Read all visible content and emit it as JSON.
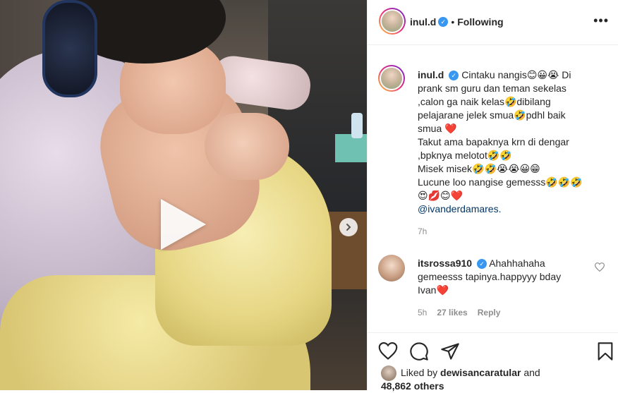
{
  "post": {
    "author": "inul.d",
    "follow_state": "Following",
    "more_label": "•••",
    "caption": {
      "username": "inul.d",
      "lines": [
        "Cintaku nangis😊😀😭 Di",
        "prank sm guru dan teman sekelas",
        ",calon ga naik kelas🤣dibilang",
        "pelajarane jelek smua🤣pdhl baik",
        "smua ❤️",
        "Takut ama bapaknya krn di dengar",
        ",bpknya melotot🤣🤣",
        "Misek misek🤣🤣😭😭😀😁",
        "Lucune loo nangise gemesss🤣🤣🤣",
        "😍💋😊❤️"
      ],
      "mention": "@ivanderdamares.",
      "time": "7h"
    },
    "comment": {
      "username": "itsrossa910",
      "text_lines": [
        "Ahahhahaha",
        "gemeesss tapinya.happyyy bday",
        "Ivan❤️"
      ],
      "time": "5h",
      "likes": "27 likes",
      "reply": "Reply"
    },
    "liked_by": {
      "prefix": "Liked by ",
      "user": "dewisancaratular",
      "suffix": " and",
      "others": "48,862 others"
    }
  },
  "icons": {
    "verified": "verified-badge-icon",
    "more": "more-options-icon",
    "play": "play-icon",
    "next": "next-arrow-icon",
    "heart": "heart-icon",
    "comment": "comment-icon",
    "share": "share-icon",
    "save": "bookmark-icon"
  },
  "colors": {
    "verified": "#3897f0",
    "mention": "#00376b",
    "muted": "#8e8e8e",
    "text": "#262626"
  }
}
